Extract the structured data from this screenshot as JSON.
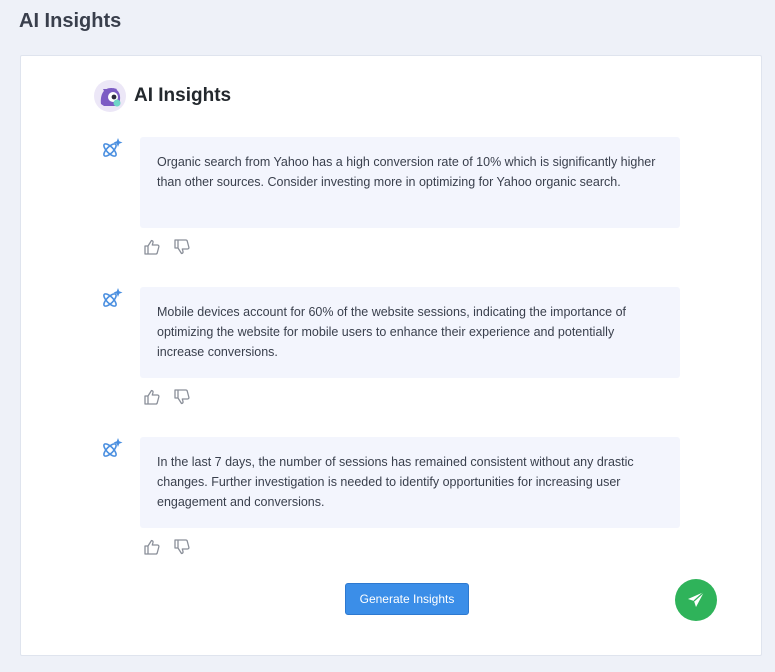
{
  "page": {
    "title": "AI Insights"
  },
  "panel": {
    "title": "AI Insights",
    "logo_icon": "monster-mascot-icon"
  },
  "insights": [
    {
      "text": "Organic search from Yahoo has a high conversion rate of 10% which is significantly higher than other sources. Consider investing more in optimizing for Yahoo organic search."
    },
    {
      "text": "Mobile devices account for 60% of the website sessions, indicating the importance of optimizing the website for mobile users to enhance their experience and potentially increase conversions."
    },
    {
      "text": "In the last 7 days, the number of sessions has remained consistent without any drastic changes. Further investigation is needed to identify opportunities for increasing user engagement and conversions."
    }
  ],
  "actions": {
    "generate_label": "Generate Insights",
    "send_icon": "paper-plane-icon"
  },
  "colors": {
    "accent_blue": "#3b8ee8",
    "send_green": "#2fb35a",
    "bubble_bg": "#f3f5fd",
    "page_bg": "#eef1f8"
  }
}
